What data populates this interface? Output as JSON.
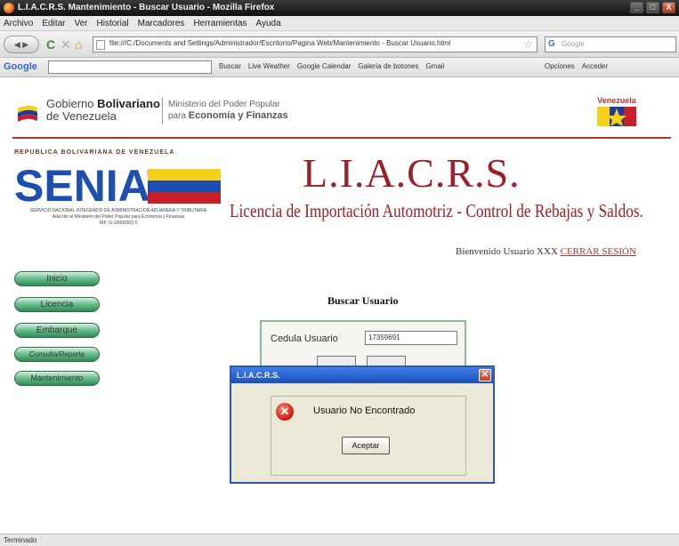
{
  "window": {
    "title": "L.I.A.C.R.S. Mantenimiento - Buscar Usuario - Mozilla Firefox",
    "controls": [
      "_",
      "□",
      "X"
    ]
  },
  "menubar": {
    "items": [
      "Archivo",
      "Editar",
      "Ver",
      "Historial",
      "Marcadores",
      "Herramientas",
      "Ayuda"
    ]
  },
  "navbar": {
    "url": "file:///C:/Documents and Settings/Administrador/Escritorio/Pagina Web/Mantenimiento - Buscar Usuario.html",
    "search_placeholder": "Google"
  },
  "google_toolbar": {
    "logo": "Google",
    "items": [
      "Buscar",
      "Live Weather",
      "Google Calendar",
      "Galería de botones",
      "Gmail"
    ],
    "right_items": [
      "Opciones",
      "Acceder"
    ]
  },
  "header": {
    "gob_line1": "Gobierno",
    "gob_line1_bold": "Bolivariano",
    "gob_line2": "de Venezuela",
    "min_line1": "Ministerio del Poder Popular",
    "min_line2_prefix": "para",
    "min_line2_bold": "Economía y Finanzas",
    "venezuela_logo": "Venezuela"
  },
  "seniat": {
    "republica": "REPUBLICA BOLIVARIANA DE VENEZUELA",
    "logo_text": "SENIAT",
    "sub1": "SERVICIO NACIONAL INTEGRADO DE ADMINISTRACION ADUANERA Y TRIBUTARIA",
    "sub2": "Adscrito al Ministerio del Poder Popular para Economía y Finanzas",
    "rif": "RIF: G-20000303-0"
  },
  "app": {
    "title": "L.I.A.C.R.S.",
    "subtitle": "Licencia de Importación Automotriz - Control de Rebajas y Saldos."
  },
  "session": {
    "welcome": "Bienvenido Usuario XXX",
    "logout": "CERRAR SESIÓN"
  },
  "side_menu": [
    "Inicio",
    "Licencia",
    "Embarque",
    "Consulta/Reporte",
    "Mantenimiento"
  ],
  "search_form": {
    "title": "Buscar Usuario",
    "field_label": "Cedula Usuario",
    "field_value": "17359691"
  },
  "dialog": {
    "title": "L.I.A.C.R.S.",
    "message": "Usuario No Encontrado",
    "button": "Aceptar"
  },
  "status": {
    "text": "Terminado"
  }
}
